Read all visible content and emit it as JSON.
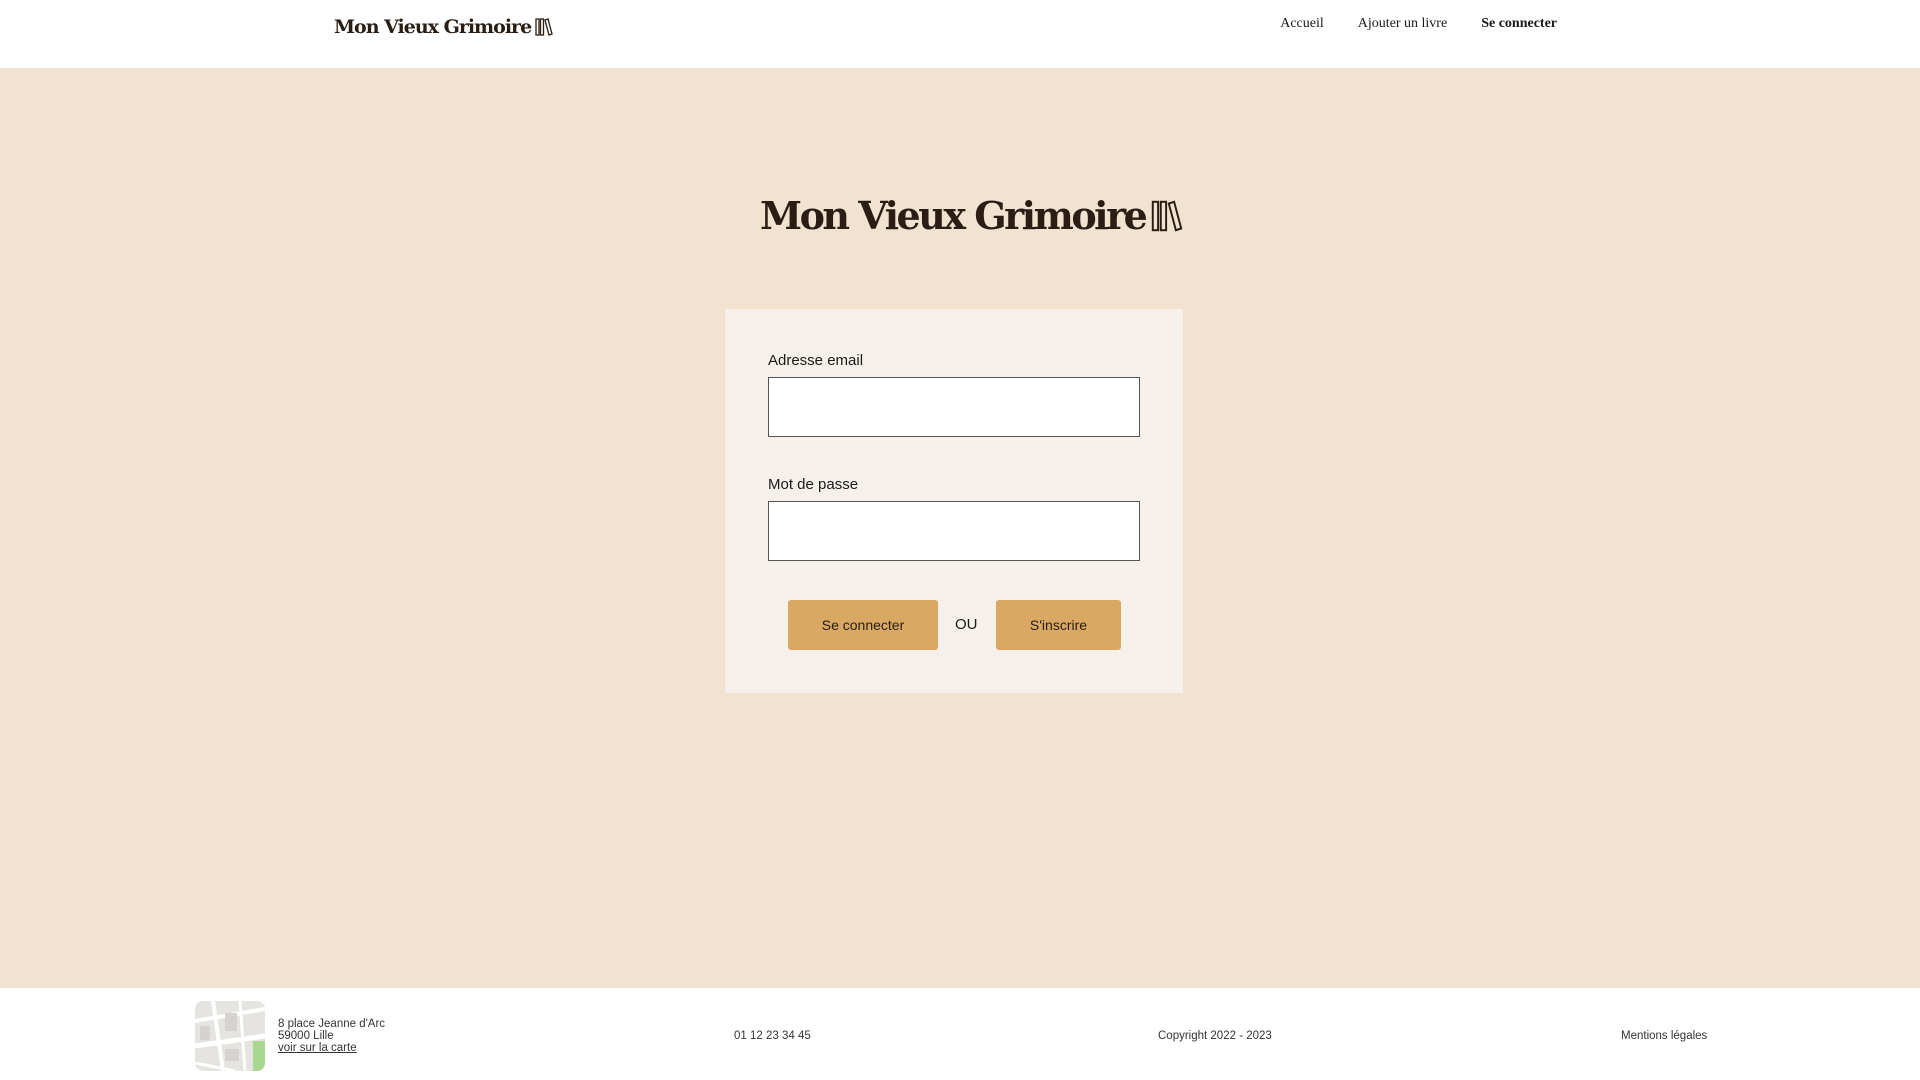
{
  "header": {
    "logo_text": "Mon Vieux Grimoire",
    "nav": {
      "home": "Accueil",
      "add_book": "Ajouter un livre",
      "login": "Se connecter"
    }
  },
  "main": {
    "logo_text": "Mon Vieux Grimoire",
    "form": {
      "email_label": "Adresse email",
      "email_value": "",
      "password_label": "Mot de passe",
      "password_value": "",
      "login_button": "Se connecter",
      "or_text": "OU",
      "signup_button": "S'inscrire"
    }
  },
  "footer": {
    "address_line1": "8 place Jeanne d'Arc",
    "address_line2": "59000 Lille",
    "map_link": "voir sur la carte",
    "phone": "01 12 23 34 45",
    "copyright": "Copyright 2022 - 2023",
    "legal": "Mentions légales"
  },
  "colors": {
    "background": "#f1e3cf",
    "card": "#f6f0ea",
    "button": "#d9a862",
    "text_dark": "#2a1d14"
  },
  "icons": {
    "logo": "books-icon",
    "map": "map-thumbnail"
  }
}
